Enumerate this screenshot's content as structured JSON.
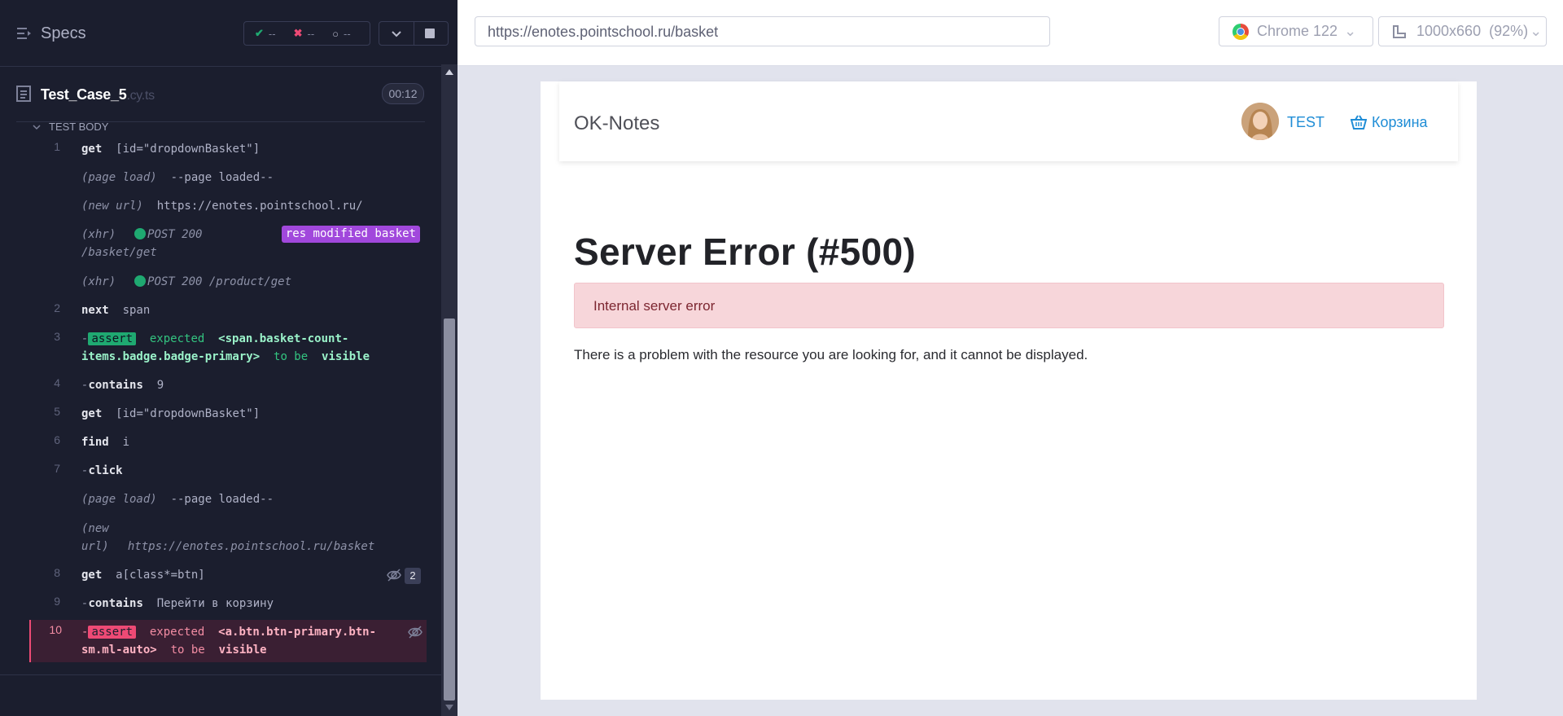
{
  "reporter": {
    "title": "Specs",
    "stats": {
      "passed": "--",
      "failed": "--",
      "pending": "--"
    },
    "spec": {
      "name": "Test_Case_5",
      "ext": ".cy.ts",
      "duration": "00:12"
    },
    "section": "TEST BODY",
    "commands": [
      {
        "num": "1",
        "name": "get",
        "msg": "[id=\"dropdownBasket\"]"
      },
      {
        "num": "",
        "event": "(page load)",
        "msg": "--page loaded--"
      },
      {
        "num": "",
        "event": "(new url)",
        "msg": "https://enotes.pointschool.ru/"
      },
      {
        "num": "",
        "event": "(xhr)",
        "msg": "POST 200",
        "msg2": "/basket/get",
        "badge": "res modified basket"
      },
      {
        "num": "",
        "event": "(xhr)",
        "msg": "POST 200 /product/get"
      },
      {
        "num": "2",
        "name": "next",
        "msg": "span"
      },
      {
        "num": "3",
        "prefix": "-",
        "assert": "assert",
        "expected": "expected",
        "subject": "<span.basket-count-items.badge.badge-primary>",
        "tobe": "to be",
        "state": "visible"
      },
      {
        "num": "4",
        "prefix": "-",
        "name": "contains",
        "msg": "9"
      },
      {
        "num": "5",
        "name": "get",
        "msg": "[id=\"dropdownBasket\"]"
      },
      {
        "num": "6",
        "name": "find",
        "msg": "i"
      },
      {
        "num": "7",
        "prefix": "-",
        "name": "click"
      },
      {
        "num": "",
        "event": "(page load)",
        "msg": "--page loaded--"
      },
      {
        "num": "",
        "event": "(new url)",
        "msg": "https://enotes.pointschool.ru/basket"
      },
      {
        "num": "8",
        "name": "get",
        "msg": "a[class*=btn]",
        "count": "2"
      },
      {
        "num": "9",
        "prefix": "-",
        "name": "contains",
        "msg": "Перейти в корзину"
      },
      {
        "num": "10",
        "prefix": "-",
        "assert": "assert",
        "expected": "expected",
        "subject": "<a.btn.btn-primary.btn-sm.ml-auto>",
        "tobe": "to be",
        "state": "visible"
      }
    ]
  },
  "browser": {
    "url": "https://enotes.pointschool.ru/basket",
    "browser": "Chrome 122",
    "viewport": "1000x660",
    "scale": "(92%)"
  },
  "app": {
    "brand": "OK-Notes",
    "user": "TEST",
    "basket": "Корзина",
    "error_title": "Server Error (#500)",
    "error_alert": "Internal server error",
    "error_desc": "There is a problem with the resource you are looking for, and it cannot be displayed."
  },
  "colors": {
    "accent_link": "#1f8dd6",
    "pass": "#1fa971",
    "fail": "#ee4a75",
    "badge_purple": "#a148dc"
  }
}
